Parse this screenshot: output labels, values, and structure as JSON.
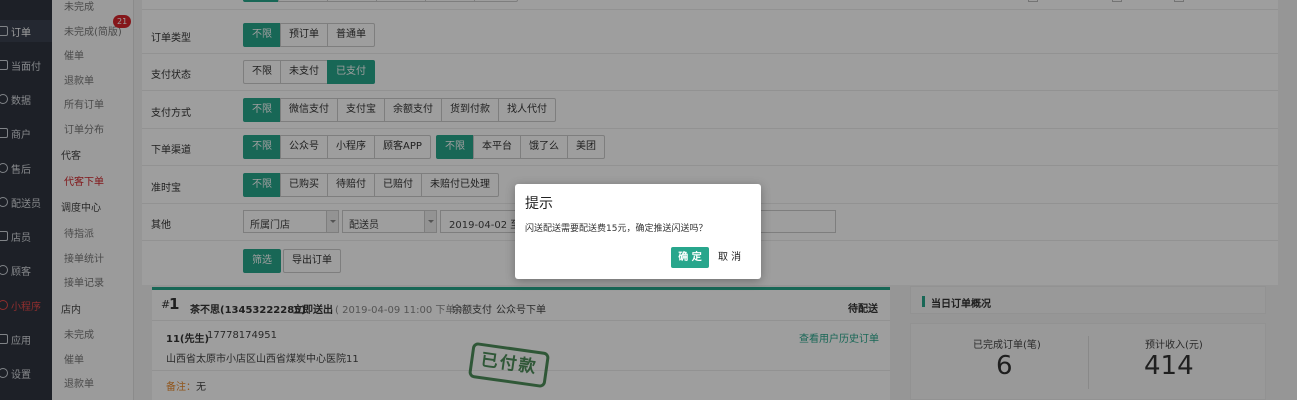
{
  "nav": [
    {
      "label": "订单",
      "icon": "document-icon"
    },
    {
      "label": "当面付",
      "icon": "document-icon"
    },
    {
      "label": "数据",
      "icon": "chart-icon"
    },
    {
      "label": "商户",
      "icon": "store-icon"
    },
    {
      "label": "售后",
      "icon": "service-icon"
    },
    {
      "label": "配送员",
      "icon": "courier-icon"
    },
    {
      "label": "店员",
      "icon": "staff-icon"
    },
    {
      "label": "顾客",
      "icon": "customer-icon"
    },
    {
      "label": "小程序",
      "icon": "mini-program-icon"
    },
    {
      "label": "应用",
      "icon": "apps-icon"
    },
    {
      "label": "设置",
      "icon": "settings-icon"
    }
  ],
  "submenu": {
    "top_items": [
      "未完成",
      "未完成(简版)",
      "催单",
      "退款单",
      "所有订单",
      "订单分布"
    ],
    "badge": "21",
    "daike_head": "代客",
    "daike_item": "代客下单",
    "dispatch_head": "调度中心",
    "dispatch_items": [
      "待指派",
      "接单统计",
      "接单记录"
    ],
    "store_head": "店内",
    "store_items": [
      "未完成",
      "催单",
      "退款单"
    ]
  },
  "filters": {
    "order_type": {
      "label": "订单类型",
      "options": [
        "不限",
        "预订单",
        "普通单"
      ]
    },
    "pay_status": {
      "label": "支付状态",
      "options": [
        "不限",
        "未支付",
        "已支付"
      ]
    },
    "pay_method": {
      "label": "支付方式",
      "options": [
        "不限",
        "微信支付",
        "支付宝",
        "余额支付",
        "货到付款",
        "找人代付"
      ]
    },
    "channel": {
      "label": "下单渠道",
      "options": [
        "不限",
        "公众号",
        "小程序",
        "顾客APP"
      ],
      "options2": [
        "不限",
        "本平台",
        "饿了么",
        "美团"
      ]
    },
    "ontime": {
      "label": "准时宝",
      "options": [
        "不限",
        "已购买",
        "待赔付",
        "已赔付",
        "未赔付已处理"
      ]
    },
    "other": {
      "label": "其他",
      "store_select": "所属门店",
      "courier_select": "配送员",
      "date_range": "2019-04-02 至 2"
    },
    "filter_button": "筛选",
    "export_button": "导出订单"
  },
  "order": {
    "number_prefix": "#",
    "number": "1",
    "customer": "茶不思(13453222285)",
    "delivery": "立即送出",
    "time": "( 2019-04-09 11:00 下单 )",
    "pay": "余额支付",
    "source": "公众号下单",
    "status": "待配送",
    "receiver": "11(先生)",
    "phone": "17778174951",
    "history_link": "查看用户历史订单",
    "address": "山西省太原市小店区山西省煤炭中心医院11",
    "note_label": "备注：",
    "note_value": "无",
    "stamp": "已付款"
  },
  "summary": {
    "title": "当日订单概况",
    "done_label": "已完成订单(笔)",
    "done_value": "6",
    "income_label": "预计收入(元)",
    "income_value": "414"
  },
  "dialog": {
    "title": "提示",
    "message": "闪送配送需要配送费15元，确定推送闪送吗？",
    "ok": "确 定",
    "cancel": "取 消"
  },
  "colors": {
    "accent": "#28a68c",
    "sidebar": "#2f3540",
    "danger": "#d7252b"
  }
}
